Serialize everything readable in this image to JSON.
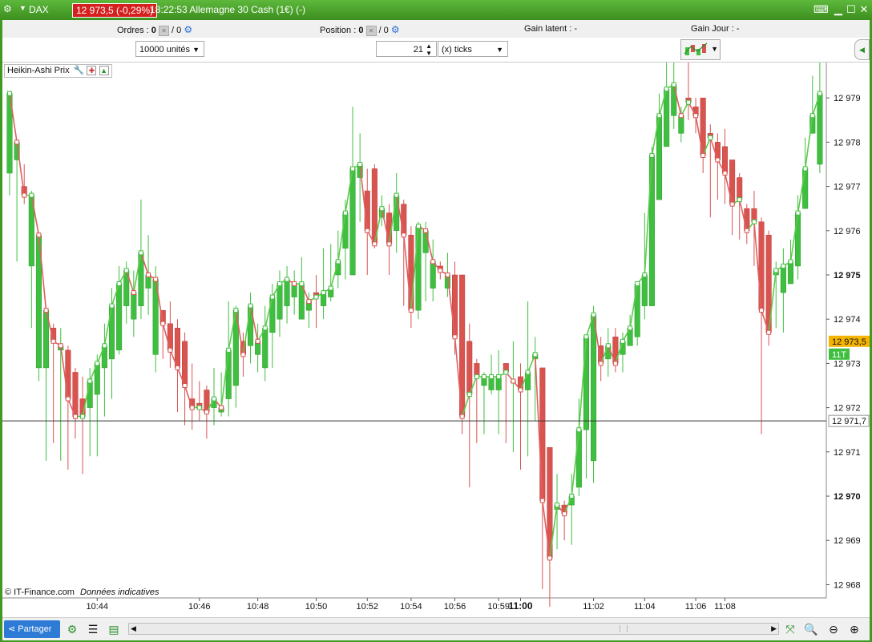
{
  "window": {
    "symbol": "DAX",
    "price_badge": "12 973,5 (-0,29%)",
    "title": "18:22:53 Allemagne 30 Cash (1€) (-)",
    "frame_color": "#3f9a22"
  },
  "toolbar": {
    "orders_label": "Ordres :",
    "orders_count": "0",
    "orders_sep": "/ 0",
    "position_label": "Position :",
    "position_count": "0",
    "position_sep": "/ 0",
    "latent_label": "Gain latent :",
    "latent_value": "-",
    "day_label": "Gain Jour :",
    "day_value": "-",
    "quantity_select": "10000 unités",
    "ticks_value": "21",
    "ticks_unit": "(x) ticks"
  },
  "chart": {
    "indicator_label": "Heikin-Ashi Prix",
    "copyright": "© IT-Finance.com",
    "disclaimer": "Données indicatives",
    "current_price_label": "12 973,5",
    "ticks_badge": "11T",
    "crosshair_label": "12 971,7",
    "colors": {
      "up": "#3fbf3f",
      "down": "#d9534f",
      "up_line": "#5ccc4a",
      "down_line": "#e06060",
      "price_badge": "#f5b400"
    }
  },
  "chart_data": {
    "type": "candlestick",
    "chart_style": "Heikin-Ashi",
    "y_ticks": [
      "12 968",
      "12 969",
      "12 970",
      "12 971",
      "12 972",
      "12 973",
      "12 974",
      "12 975",
      "12 976",
      "12 977",
      "12 978",
      "12 979"
    ],
    "y_tick_values": [
      12968,
      12969,
      12970,
      12971,
      12972,
      12973,
      12974,
      12975,
      12976,
      12977,
      12978,
      12979
    ],
    "bold_y_ticks": [
      "12 970",
      "12 975"
    ],
    "ylim": [
      12967.7,
      12979.8
    ],
    "x_tick_labels": [
      "10:44",
      "10:46",
      "10:48",
      "10:50",
      "10:52",
      "10:54",
      "10:56",
      "10:59",
      "11:00",
      "11:02",
      "11:04",
      "11:06",
      "11:08"
    ],
    "x_tick_bars": [
      12,
      26,
      34,
      42,
      49,
      55,
      61,
      67,
      70,
      80,
      87,
      94,
      98
    ],
    "bold_x_ticks": [
      "11:00"
    ],
    "last_price": 12973.5,
    "crosshair_price": 12971.7,
    "candles": [
      {
        "o": 12977.3,
        "c": 12979.1,
        "h": 12979.1,
        "l": 12976.8
      },
      {
        "o": 12977.6,
        "c": 12978.0,
        "h": 12978.0,
        "l": 12975.3
      },
      {
        "o": 12977.0,
        "c": 12976.8,
        "h": 12977.5,
        "l": 12976.6
      },
      {
        "o": 12975.2,
        "c": 12976.8,
        "h": 12976.9,
        "l": 12973.8
      },
      {
        "o": 12972.9,
        "c": 12975.9,
        "h": 12975.9,
        "l": 12972.6
      },
      {
        "o": 12972.9,
        "c": 12974.2,
        "h": 12974.2,
        "l": 12970.8
      },
      {
        "o": 12973.8,
        "c": 12973.5,
        "h": 12973.9,
        "l": 12971.2
      },
      {
        "o": 12973.3,
        "c": 12973.4,
        "h": 12973.8,
        "l": 12970.8
      },
      {
        "o": 12973.3,
        "c": 12972.2,
        "h": 12973.4,
        "l": 12970.6
      },
      {
        "o": 12972.8,
        "c": 12971.8,
        "h": 12972.9,
        "l": 12971.3
      },
      {
        "o": 12972.2,
        "c": 12971.8,
        "h": 12972.7,
        "l": 12970.5
      },
      {
        "o": 12972.0,
        "c": 12972.6,
        "h": 12972.9,
        "l": 12970.9
      },
      {
        "o": 12972.3,
        "c": 12973.0,
        "h": 12973.2,
        "l": 12970.9
      },
      {
        "o": 12972.9,
        "c": 12973.4,
        "h": 12973.9,
        "l": 12971.8
      },
      {
        "o": 12973.1,
        "c": 12974.3,
        "h": 12974.7,
        "l": 12972.2
      },
      {
        "o": 12973.3,
        "c": 12974.8,
        "h": 12975.2,
        "l": 12973.2
      },
      {
        "o": 12974.3,
        "c": 12975.1,
        "h": 12975.3,
        "l": 12973.9
      },
      {
        "o": 12974.0,
        "c": 12974.6,
        "h": 12975.1,
        "l": 12973.6
      },
      {
        "o": 12974.3,
        "c": 12975.5,
        "h": 12976.7,
        "l": 12974.0
      },
      {
        "o": 12974.7,
        "c": 12975.0,
        "h": 12975.9,
        "l": 12974.1
      },
      {
        "o": 12973.2,
        "c": 12974.9,
        "h": 12975.2,
        "l": 12972.8
      },
      {
        "o": 12974.2,
        "c": 12973.9,
        "h": 12974.2,
        "l": 12973.1
      },
      {
        "o": 12973.9,
        "c": 12973.3,
        "h": 12974.4,
        "l": 12972.9
      },
      {
        "o": 12973.8,
        "c": 12972.9,
        "h": 12974.0,
        "l": 12971.9
      },
      {
        "o": 12973.5,
        "c": 12972.5,
        "h": 12973.7,
        "l": 12971.6
      },
      {
        "o": 12972.2,
        "c": 12972.0,
        "h": 12973.0,
        "l": 12971.5
      },
      {
        "o": 12972.1,
        "c": 12972.0,
        "h": 12972.6,
        "l": 12971.7
      },
      {
        "o": 12972.4,
        "c": 12971.9,
        "h": 12972.5,
        "l": 12971.3
      },
      {
        "o": 12972.0,
        "c": 12972.2,
        "h": 12972.9,
        "l": 12971.6
      },
      {
        "o": 12971.9,
        "c": 12972.0,
        "h": 12972.8,
        "l": 12971.8
      },
      {
        "o": 12972.2,
        "c": 12973.3,
        "h": 12974.4,
        "l": 12971.8
      },
      {
        "o": 12972.5,
        "c": 12974.2,
        "h": 12974.3,
        "l": 12972.0
      },
      {
        "o": 12973.5,
        "c": 12973.2,
        "h": 12973.7,
        "l": 12972.7
      },
      {
        "o": 12973.4,
        "c": 12974.3,
        "h": 12974.6,
        "l": 12973.0
      },
      {
        "o": 12973.2,
        "c": 12973.5,
        "h": 12973.9,
        "l": 12972.8
      },
      {
        "o": 12972.9,
        "c": 12973.8,
        "h": 12974.3,
        "l": 12972.6
      },
      {
        "o": 12973.7,
        "c": 12974.5,
        "h": 12974.8,
        "l": 12972.9
      },
      {
        "o": 12974.0,
        "c": 12974.8,
        "h": 12975.1,
        "l": 12973.6
      },
      {
        "o": 12974.3,
        "c": 12974.9,
        "h": 12975.2,
        "l": 12973.9
      },
      {
        "o": 12974.5,
        "c": 12974.8,
        "h": 12975.1,
        "l": 12974.1
      },
      {
        "o": 12974.0,
        "c": 12974.8,
        "h": 12975.4,
        "l": 12974.0
      },
      {
        "o": 12974.2,
        "c": 12974.4,
        "h": 12974.6,
        "l": 12973.8
      },
      {
        "o": 12974.6,
        "c": 12974.5,
        "h": 12975.0,
        "l": 12973.8
      },
      {
        "o": 12974.3,
        "c": 12974.6,
        "h": 12975.6,
        "l": 12974.0
      },
      {
        "o": 12974.5,
        "c": 12974.7,
        "h": 12975.7,
        "l": 12974.4
      },
      {
        "o": 12975.0,
        "c": 12975.3,
        "h": 12976.0,
        "l": 12974.7
      },
      {
        "o": 12975.6,
        "c": 12976.4,
        "h": 12976.7,
        "l": 12974.9
      },
      {
        "o": 12975.0,
        "c": 12977.4,
        "h": 12978.8,
        "l": 12975.0
      },
      {
        "o": 12977.2,
        "c": 12977.5,
        "h": 12978.2,
        "l": 12976.2
      },
      {
        "o": 12976.9,
        "c": 12976.0,
        "h": 12977.4,
        "l": 12975.0
      },
      {
        "o": 12977.4,
        "c": 12975.7,
        "h": 12977.5,
        "l": 12975.6
      },
      {
        "o": 12976.3,
        "c": 12976.5,
        "h": 12976.8,
        "l": 12976.1
      },
      {
        "o": 12976.4,
        "c": 12975.7,
        "h": 12976.6,
        "l": 12975.0
      },
      {
        "o": 12976.0,
        "c": 12976.8,
        "h": 12977.3,
        "l": 12975.5
      },
      {
        "o": 12976.6,
        "c": 12975.9,
        "h": 12976.7,
        "l": 12974.3
      },
      {
        "o": 12975.9,
        "c": 12974.2,
        "h": 12976.1,
        "l": 12973.8
      },
      {
        "o": 12974.2,
        "c": 12976.1,
        "h": 12976.2,
        "l": 12974.0
      },
      {
        "o": 12975.5,
        "c": 12976.0,
        "h": 12976.2,
        "l": 12974.4
      },
      {
        "o": 12974.7,
        "c": 12975.3,
        "h": 12975.8,
        "l": 12974.4
      },
      {
        "o": 12975.2,
        "c": 12975.1,
        "h": 12975.3,
        "l": 12974.9
      },
      {
        "o": 12974.7,
        "c": 12975.0,
        "h": 12975.5,
        "l": 12974.5
      },
      {
        "o": 12975.0,
        "c": 12973.6,
        "h": 12975.3,
        "l": 12973.2
      },
      {
        "o": 12975.0,
        "c": 12971.8,
        "h": 12975.0,
        "l": 12971.4
      },
      {
        "o": 12973.5,
        "c": 12972.3,
        "h": 12973.9,
        "l": 12970.2
      },
      {
        "o": 12973.0,
        "c": 12972.7,
        "h": 12973.1,
        "l": 12971.2
      },
      {
        "o": 12972.5,
        "c": 12972.7,
        "h": 12972.8,
        "l": 12971.4
      },
      {
        "o": 12972.4,
        "c": 12972.7,
        "h": 12973.2,
        "l": 12972.3
      },
      {
        "o": 12972.4,
        "c": 12972.7,
        "h": 12973.3,
        "l": 12971.4
      },
      {
        "o": 12973.0,
        "c": 12972.8,
        "h": 12973.0,
        "l": 12971.2
      },
      {
        "o": 12972.6,
        "c": 12972.6,
        "h": 12973.5,
        "l": 12971.0
      },
      {
        "o": 12972.7,
        "c": 12972.4,
        "h": 12973.0,
        "l": 12970.6
      },
      {
        "o": 12972.4,
        "c": 12972.8,
        "h": 12974.4,
        "l": 12970.9
      },
      {
        "o": 12973.1,
        "c": 12973.2,
        "h": 12973.6,
        "l": 12971.7
      },
      {
        "o": 12972.9,
        "c": 12969.9,
        "h": 12972.9,
        "l": 12967.9
      },
      {
        "o": 12971.1,
        "c": 12968.6,
        "h": 12971.1,
        "l": 12967.5
      },
      {
        "o": 12969.7,
        "c": 12969.8,
        "h": 12970.5,
        "l": 12968.8
      },
      {
        "o": 12969.8,
        "c": 12969.6,
        "h": 12969.9,
        "l": 12969.0
      },
      {
        "o": 12969.8,
        "c": 12970.0,
        "h": 12970.5,
        "l": 12968.9
      },
      {
        "o": 12970.2,
        "c": 12971.5,
        "h": 12972.2,
        "l": 12970.0
      },
      {
        "o": 12971.5,
        "c": 12973.6,
        "h": 12973.6,
        "l": 12970.4
      },
      {
        "o": 12970.8,
        "c": 12974.1,
        "h": 12974.3,
        "l": 12970.3
      },
      {
        "o": 12973.4,
        "c": 12973.0,
        "h": 12973.6,
        "l": 12972.6
      },
      {
        "o": 12973.1,
        "c": 12973.4,
        "h": 12973.8,
        "l": 12972.7
      },
      {
        "o": 12973.6,
        "c": 12973.0,
        "h": 12973.8,
        "l": 12972.8
      },
      {
        "o": 12973.2,
        "c": 12973.5,
        "h": 12973.7,
        "l": 12972.8
      },
      {
        "o": 12973.4,
        "c": 12973.8,
        "h": 12974.1,
        "l": 12973.4
      },
      {
        "o": 12973.6,
        "c": 12974.8,
        "h": 12974.8,
        "l": 12973.4
      },
      {
        "o": 12974.3,
        "c": 12975.0,
        "h": 12976.4,
        "l": 12974.0
      },
      {
        "o": 12974.3,
        "c": 12977.7,
        "h": 12977.9,
        "l": 12974.3
      },
      {
        "o": 12976.7,
        "c": 12978.6,
        "h": 12979.1,
        "l": 12976.7
      },
      {
        "o": 12977.9,
        "c": 12979.2,
        "h": 12979.8,
        "l": 12977.9
      },
      {
        "o": 12978.6,
        "c": 12979.3,
        "h": 12979.8,
        "l": 12978.3
      },
      {
        "o": 12978.2,
        "c": 12978.6,
        "h": 12978.8,
        "l": 12978.0
      },
      {
        "o": 12979.0,
        "c": 12978.9,
        "h": 12979.8,
        "l": 12978.5
      },
      {
        "o": 12978.8,
        "c": 12978.6,
        "h": 12979.0,
        "l": 12978.2
      },
      {
        "o": 12979.0,
        "c": 12977.7,
        "h": 12979.0,
        "l": 12977.3
      },
      {
        "o": 12978.2,
        "c": 12978.1,
        "h": 12978.4,
        "l": 12976.3
      },
      {
        "o": 12978.0,
        "c": 12977.6,
        "h": 12978.2,
        "l": 12976.7
      },
      {
        "o": 12977.9,
        "c": 12977.3,
        "h": 12978.3,
        "l": 12976.6
      },
      {
        "o": 12977.6,
        "c": 12976.6,
        "h": 12977.6,
        "l": 12975.9
      },
      {
        "o": 12977.2,
        "c": 12976.7,
        "h": 12977.3,
        "l": 12975.8
      },
      {
        "o": 12976.5,
        "c": 12976.0,
        "h": 12976.6,
        "l": 12975.7
      },
      {
        "o": 12976.5,
        "c": 12976.2,
        "h": 12976.9,
        "l": 12975.2
      },
      {
        "o": 12976.2,
        "c": 12974.2,
        "h": 12976.3,
        "l": 12971.4
      },
      {
        "o": 12975.9,
        "c": 12973.7,
        "h": 12976.0,
        "l": 12973.4
      },
      {
        "o": 12975.0,
        "c": 12975.1,
        "h": 12975.3,
        "l": 12973.8
      },
      {
        "o": 12974.6,
        "c": 12975.2,
        "h": 12975.6,
        "l": 12973.7
      },
      {
        "o": 12974.8,
        "c": 12975.3,
        "h": 12975.8,
        "l": 12974.8
      },
      {
        "o": 12975.2,
        "c": 12976.4,
        "h": 12976.8,
        "l": 12974.9
      },
      {
        "o": 12976.5,
        "c": 12977.4,
        "h": 12978.1,
        "l": 12976.5
      },
      {
        "o": 12978.2,
        "c": 12978.6,
        "h": 12979.5,
        "l": 12978.2
      },
      {
        "o": 12977.5,
        "c": 12979.1,
        "h": 12979.8,
        "l": 12977.3
      }
    ]
  },
  "footer": {
    "share_label": "Partager"
  }
}
